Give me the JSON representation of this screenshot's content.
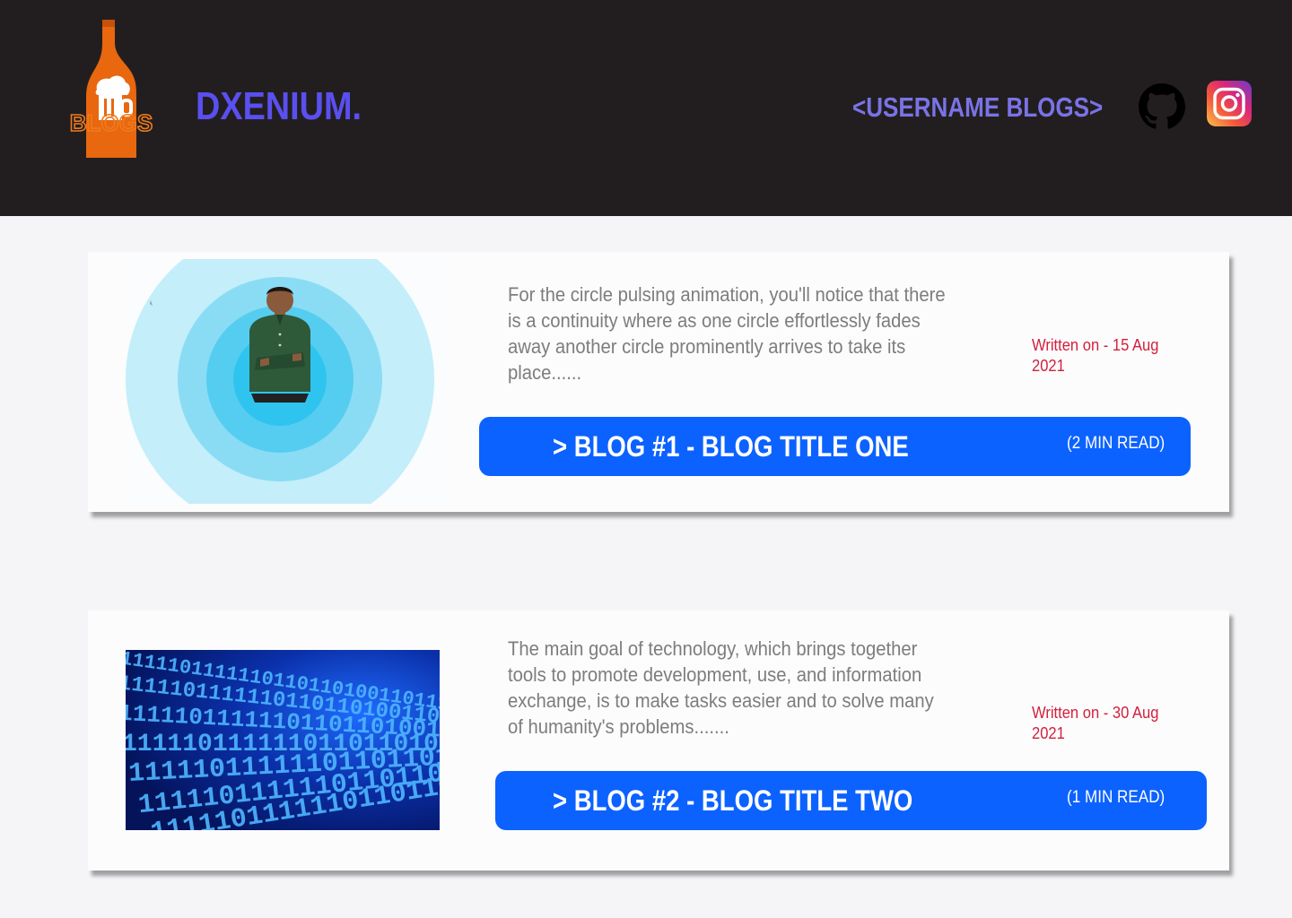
{
  "header": {
    "logo_text": "BLOGS",
    "brand": "DXENIUM.",
    "user_blogs": "<USERNAME BLOGS>",
    "github_icon": "github-icon",
    "instagram_icon": "instagram-icon"
  },
  "colors": {
    "header_bg": "#221e1f",
    "brand": "#5a4ff0",
    "accent_button": "#0c62ff",
    "date": "#d21f3c",
    "excerpt": "#7d7d7d"
  },
  "posts": [
    {
      "excerpt": "For the circle pulsing animation, you'll notice that there is a continuity where as one circle effortlessly fades away another circle prominently arrives to take its place......",
      "written": "Written on - 15 Aug 2021",
      "title": "> BLOG #1 - BLOG TITLE ONE",
      "read_time": "(2 MIN READ)"
    },
    {
      "excerpt": "The main goal of technology, which brings together tools to promote development, use, and information exchange, is to make tasks easier and to solve many of humanity's problems.......",
      "written": "Written on - 30 Aug 2021",
      "title": "> BLOG #2 - BLOG TITLE TWO",
      "read_time": "(1 MIN READ)",
      "binary_text": "1111101111110110110100110111001011000100100011001110111110110011011101110000111110101010101001110000011111000111101101"
    }
  ]
}
